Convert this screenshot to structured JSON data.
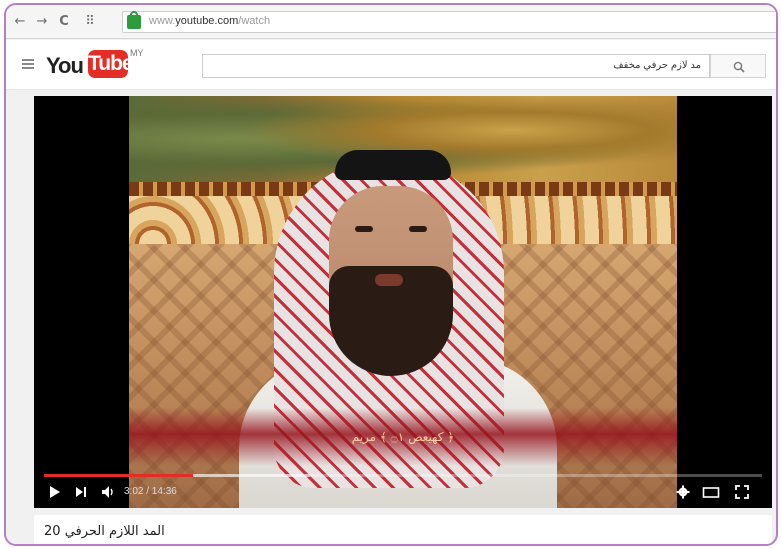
{
  "browser": {
    "url_prefix": "www.",
    "url_domain": "youtube.com",
    "url_path": "/watch",
    "back_icon": "←",
    "forward_icon": "→",
    "reload_icon": "C",
    "apps_icon": "⠿"
  },
  "header": {
    "logo_you": "You",
    "logo_tube": "Tube",
    "logo_region": "MY",
    "search_value": "مد لازم حرفي مخفف"
  },
  "player": {
    "caption": "﴿ كهيعص ۝١ ﴾ مريم",
    "current_time": "3:02",
    "duration": "14:36",
    "time_display": "3:02 / 14:36",
    "progress_fraction": 0.207,
    "buffer_fraction": 0.37
  },
  "video": {
    "title": "20 المد اللازم الحرفي"
  },
  "colors": {
    "accent": "#e52d27",
    "frame_border": "#b47fc6"
  }
}
